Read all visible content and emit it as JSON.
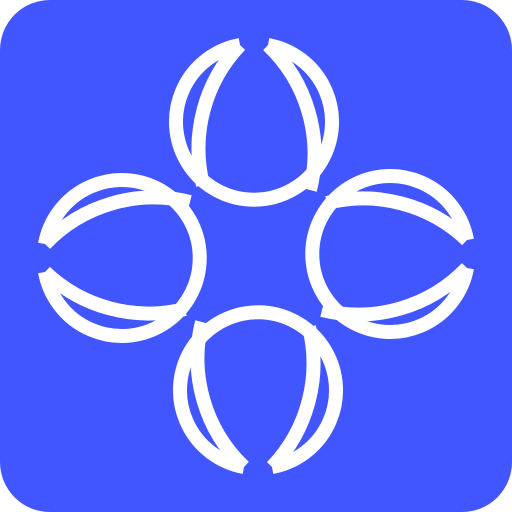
{
  "icon": {
    "name": "floral-knot-logo-icon",
    "background_color": "#4156FF",
    "mark_color": "#FFFFFF"
  }
}
